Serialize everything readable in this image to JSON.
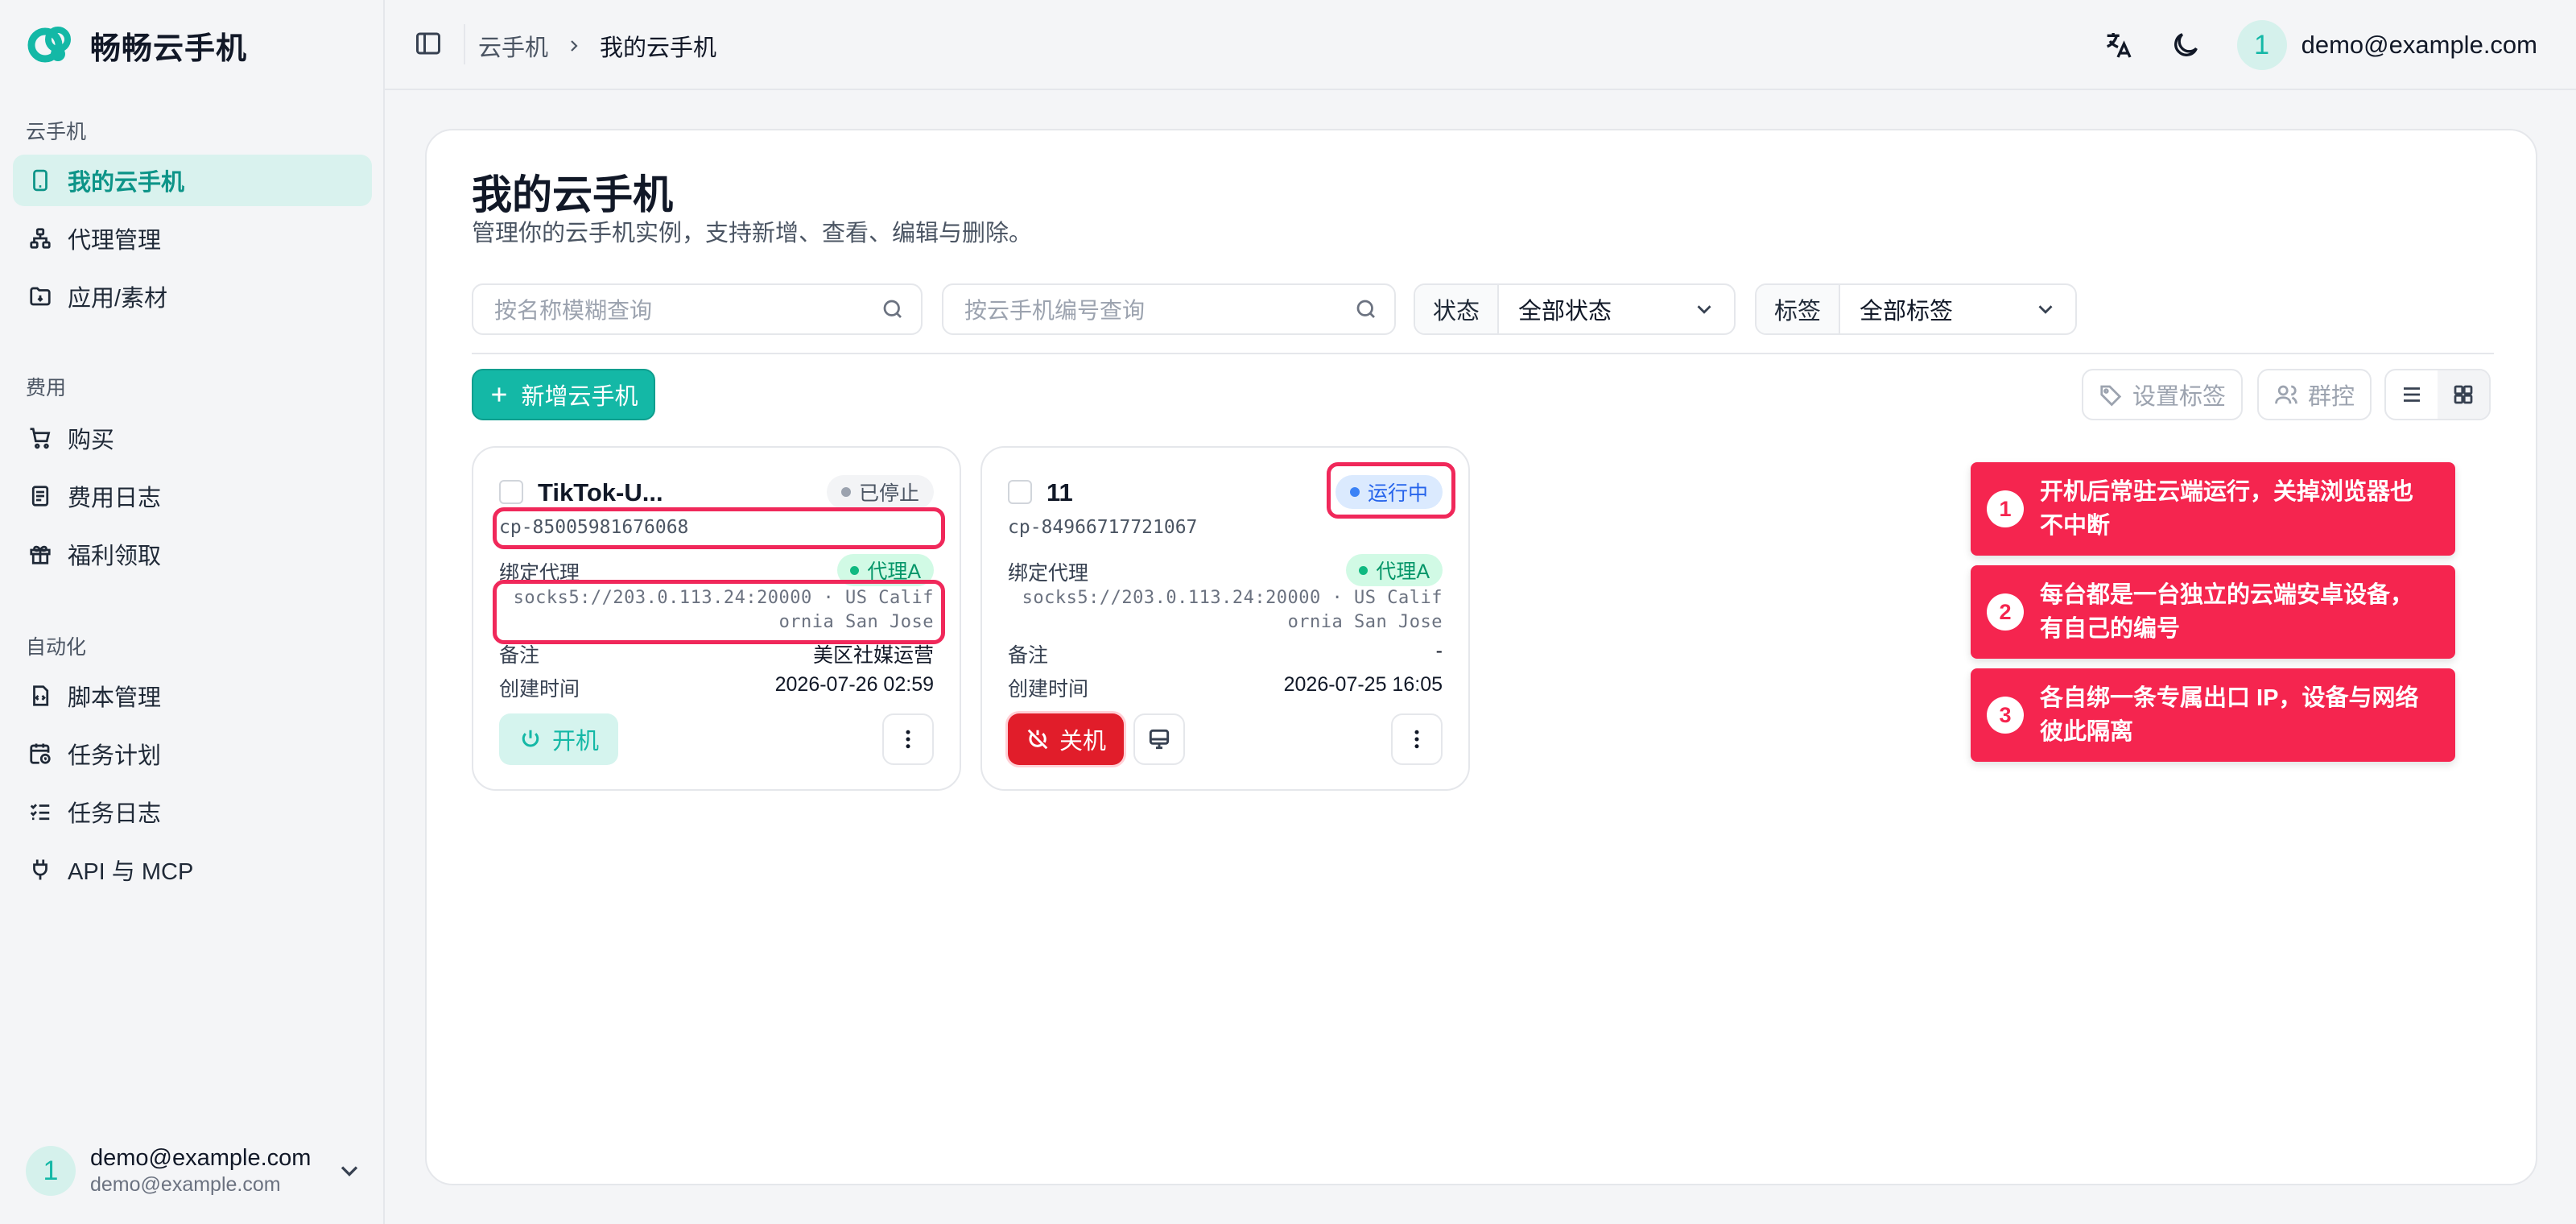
{
  "brand": {
    "name": "畅畅云手机"
  },
  "sidebar": {
    "sections": [
      {
        "title": "云手机",
        "items": [
          {
            "label": "我的云手机"
          },
          {
            "label": "代理管理"
          },
          {
            "label": "应用/素材"
          }
        ]
      },
      {
        "title": "费用",
        "items": [
          {
            "label": "购买"
          },
          {
            "label": "费用日志"
          },
          {
            "label": "福利领取"
          }
        ]
      },
      {
        "title": "自动化",
        "items": [
          {
            "label": "脚本管理"
          },
          {
            "label": "任务计划"
          },
          {
            "label": "任务日志"
          },
          {
            "label": "API 与 MCP"
          }
        ]
      }
    ],
    "user": {
      "avatar": "1",
      "name": "demo@example.com",
      "email": "demo@example.com"
    }
  },
  "header": {
    "breadcrumb": [
      "云手机",
      "我的云手机"
    ],
    "user": {
      "avatar": "1",
      "email": "demo@example.com"
    }
  },
  "main": {
    "title": "我的云手机",
    "subtitle": "管理你的云手机实例，支持新增、查看、编辑与删除。",
    "filters": {
      "name_placeholder": "按名称模糊查询",
      "code_placeholder": "按云手机编号查询",
      "status_label": "状态",
      "status_value": "全部状态",
      "tag_label": "标签",
      "tag_value": "全部标签"
    },
    "toolbar": {
      "add_label": "新增云手机",
      "set_tag_label": "设置标签",
      "group_control_label": "群控"
    },
    "devices": [
      {
        "name": "TikTok-U...",
        "status": "已停止",
        "code": "cp-85005981676068",
        "proxy_label": "绑定代理",
        "proxy_name": "代理A",
        "proxy_addr_1": "socks5://203.0.113.24:20000 · US Calif",
        "proxy_addr_2": "ornia San Jose",
        "note_label": "备注",
        "note": "美区社媒运营",
        "created_label": "创建时间",
        "created": "2026-07-26 02:59",
        "power_label": "开机"
      },
      {
        "name": "11",
        "status": "运行中",
        "code": "cp-84966717721067",
        "proxy_label": "绑定代理",
        "proxy_name": "代理A",
        "proxy_addr_1": "socks5://203.0.113.24:20000 · US Calif",
        "proxy_addr_2": "ornia San Jose",
        "note_label": "备注",
        "note": "-",
        "created_label": "创建时间",
        "created": "2026-07-25 16:05",
        "power_label": "关机"
      }
    ]
  },
  "callouts": [
    {
      "num": "1",
      "text": "开机后常驻云端运行，关掉浏览器也不中断"
    },
    {
      "num": "2",
      "text": "每台都是一台独立的云端安卓设备，有自己的编号"
    },
    {
      "num": "3",
      "text": "各自绑一条专属出口 IP，设备与网络彼此隔离"
    }
  ],
  "colors": {
    "accent": "#14b8a6",
    "highlight": "#f0285a",
    "danger": "#e11d2a"
  }
}
